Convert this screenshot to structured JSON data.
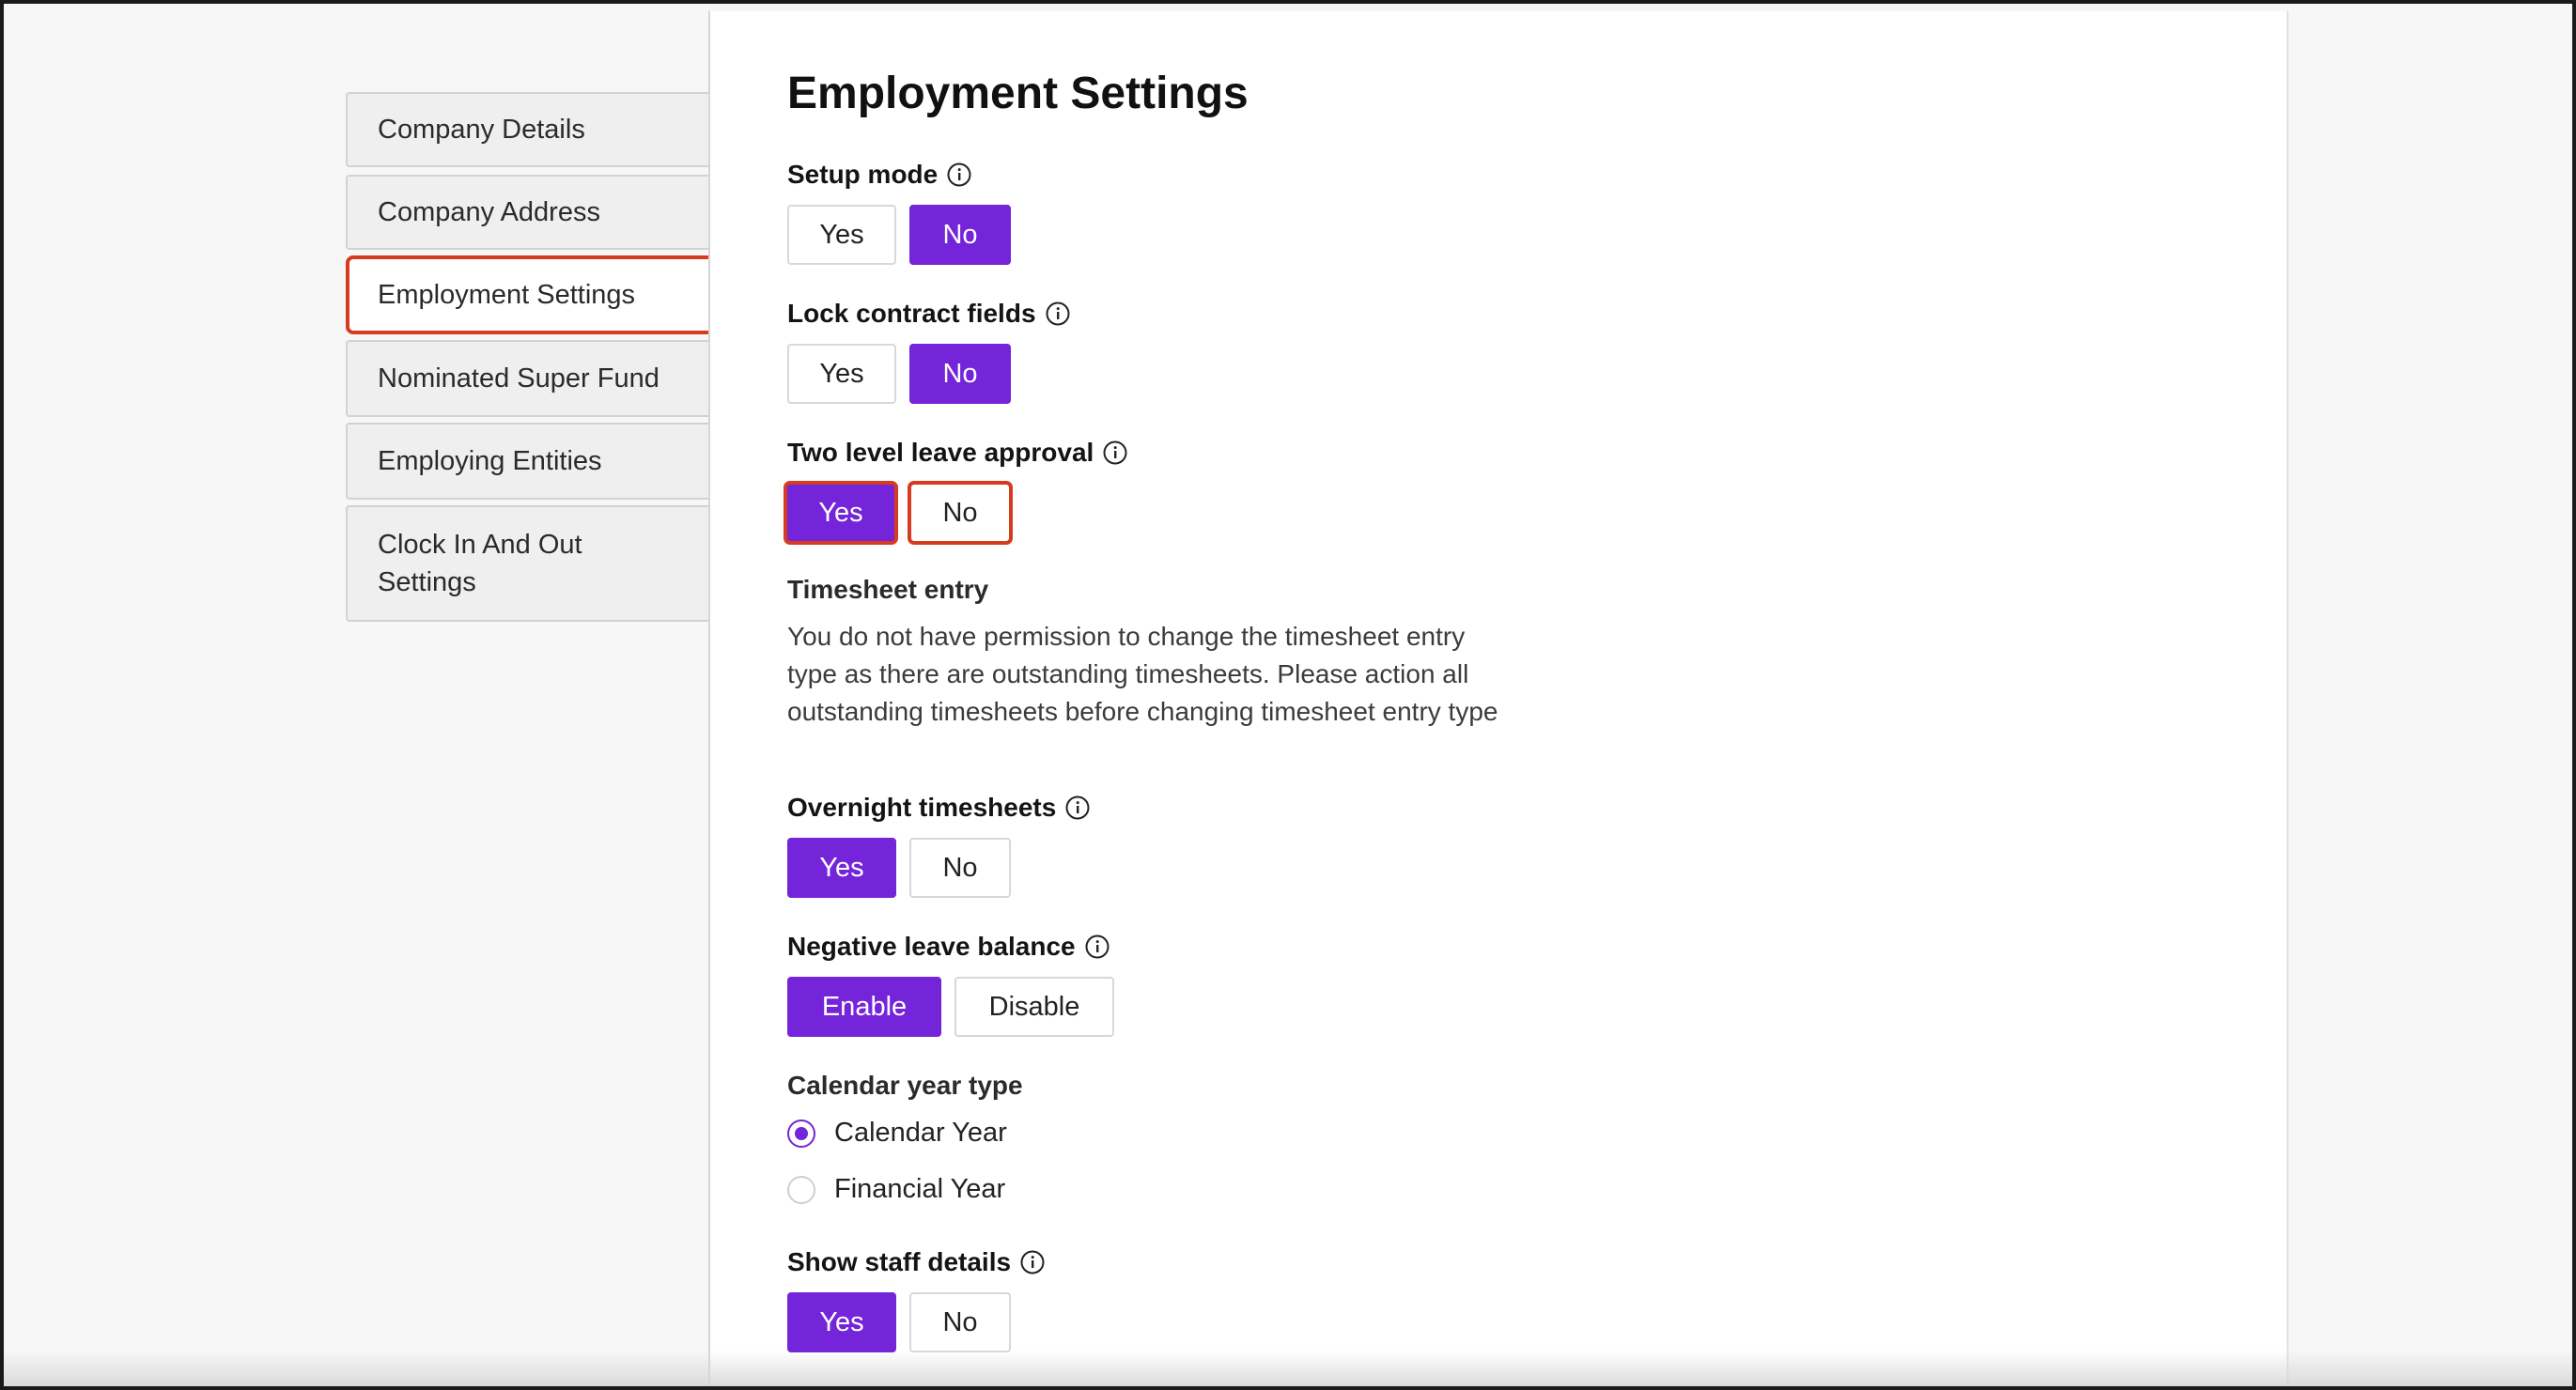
{
  "sidebar": {
    "items": [
      {
        "label": "Company Details"
      },
      {
        "label": "Company Address"
      },
      {
        "label": "Employment Settings"
      },
      {
        "label": "Nominated Super Fund"
      },
      {
        "label": "Employing Entities"
      },
      {
        "label": "Clock In And Out Settings"
      }
    ]
  },
  "main": {
    "title": "Employment Settings",
    "setup_mode": {
      "label": "Setup mode",
      "yes": "Yes",
      "no": "No",
      "selected": "No"
    },
    "lock_contract": {
      "label": "Lock contract fields",
      "yes": "Yes",
      "no": "No",
      "selected": "No"
    },
    "two_level": {
      "label": "Two level leave approval",
      "yes": "Yes",
      "no": "No",
      "selected": "Yes"
    },
    "timesheet_entry": {
      "label": "Timesheet entry",
      "description": "You do not have permission to change the timesheet entry type as there are outstanding timesheets. Please action all outstanding timesheets before changing timesheet entry type"
    },
    "overnight": {
      "label": "Overnight timesheets",
      "yes": "Yes",
      "no": "No",
      "selected": "Yes"
    },
    "negative_leave": {
      "label": "Negative leave balance",
      "enable": "Enable",
      "disable": "Disable",
      "selected": "Enable"
    },
    "calendar_year": {
      "label": "Calendar year type",
      "options": [
        "Calendar Year",
        "Financial Year"
      ],
      "selected": "Calendar Year"
    },
    "show_staff": {
      "label": "Show staff details",
      "yes": "Yes",
      "no": "No",
      "selected": "Yes"
    }
  },
  "icons": {
    "info": "info-circle-icon"
  },
  "colors": {
    "accent": "#7424d9",
    "highlight": "#d63a1f"
  }
}
